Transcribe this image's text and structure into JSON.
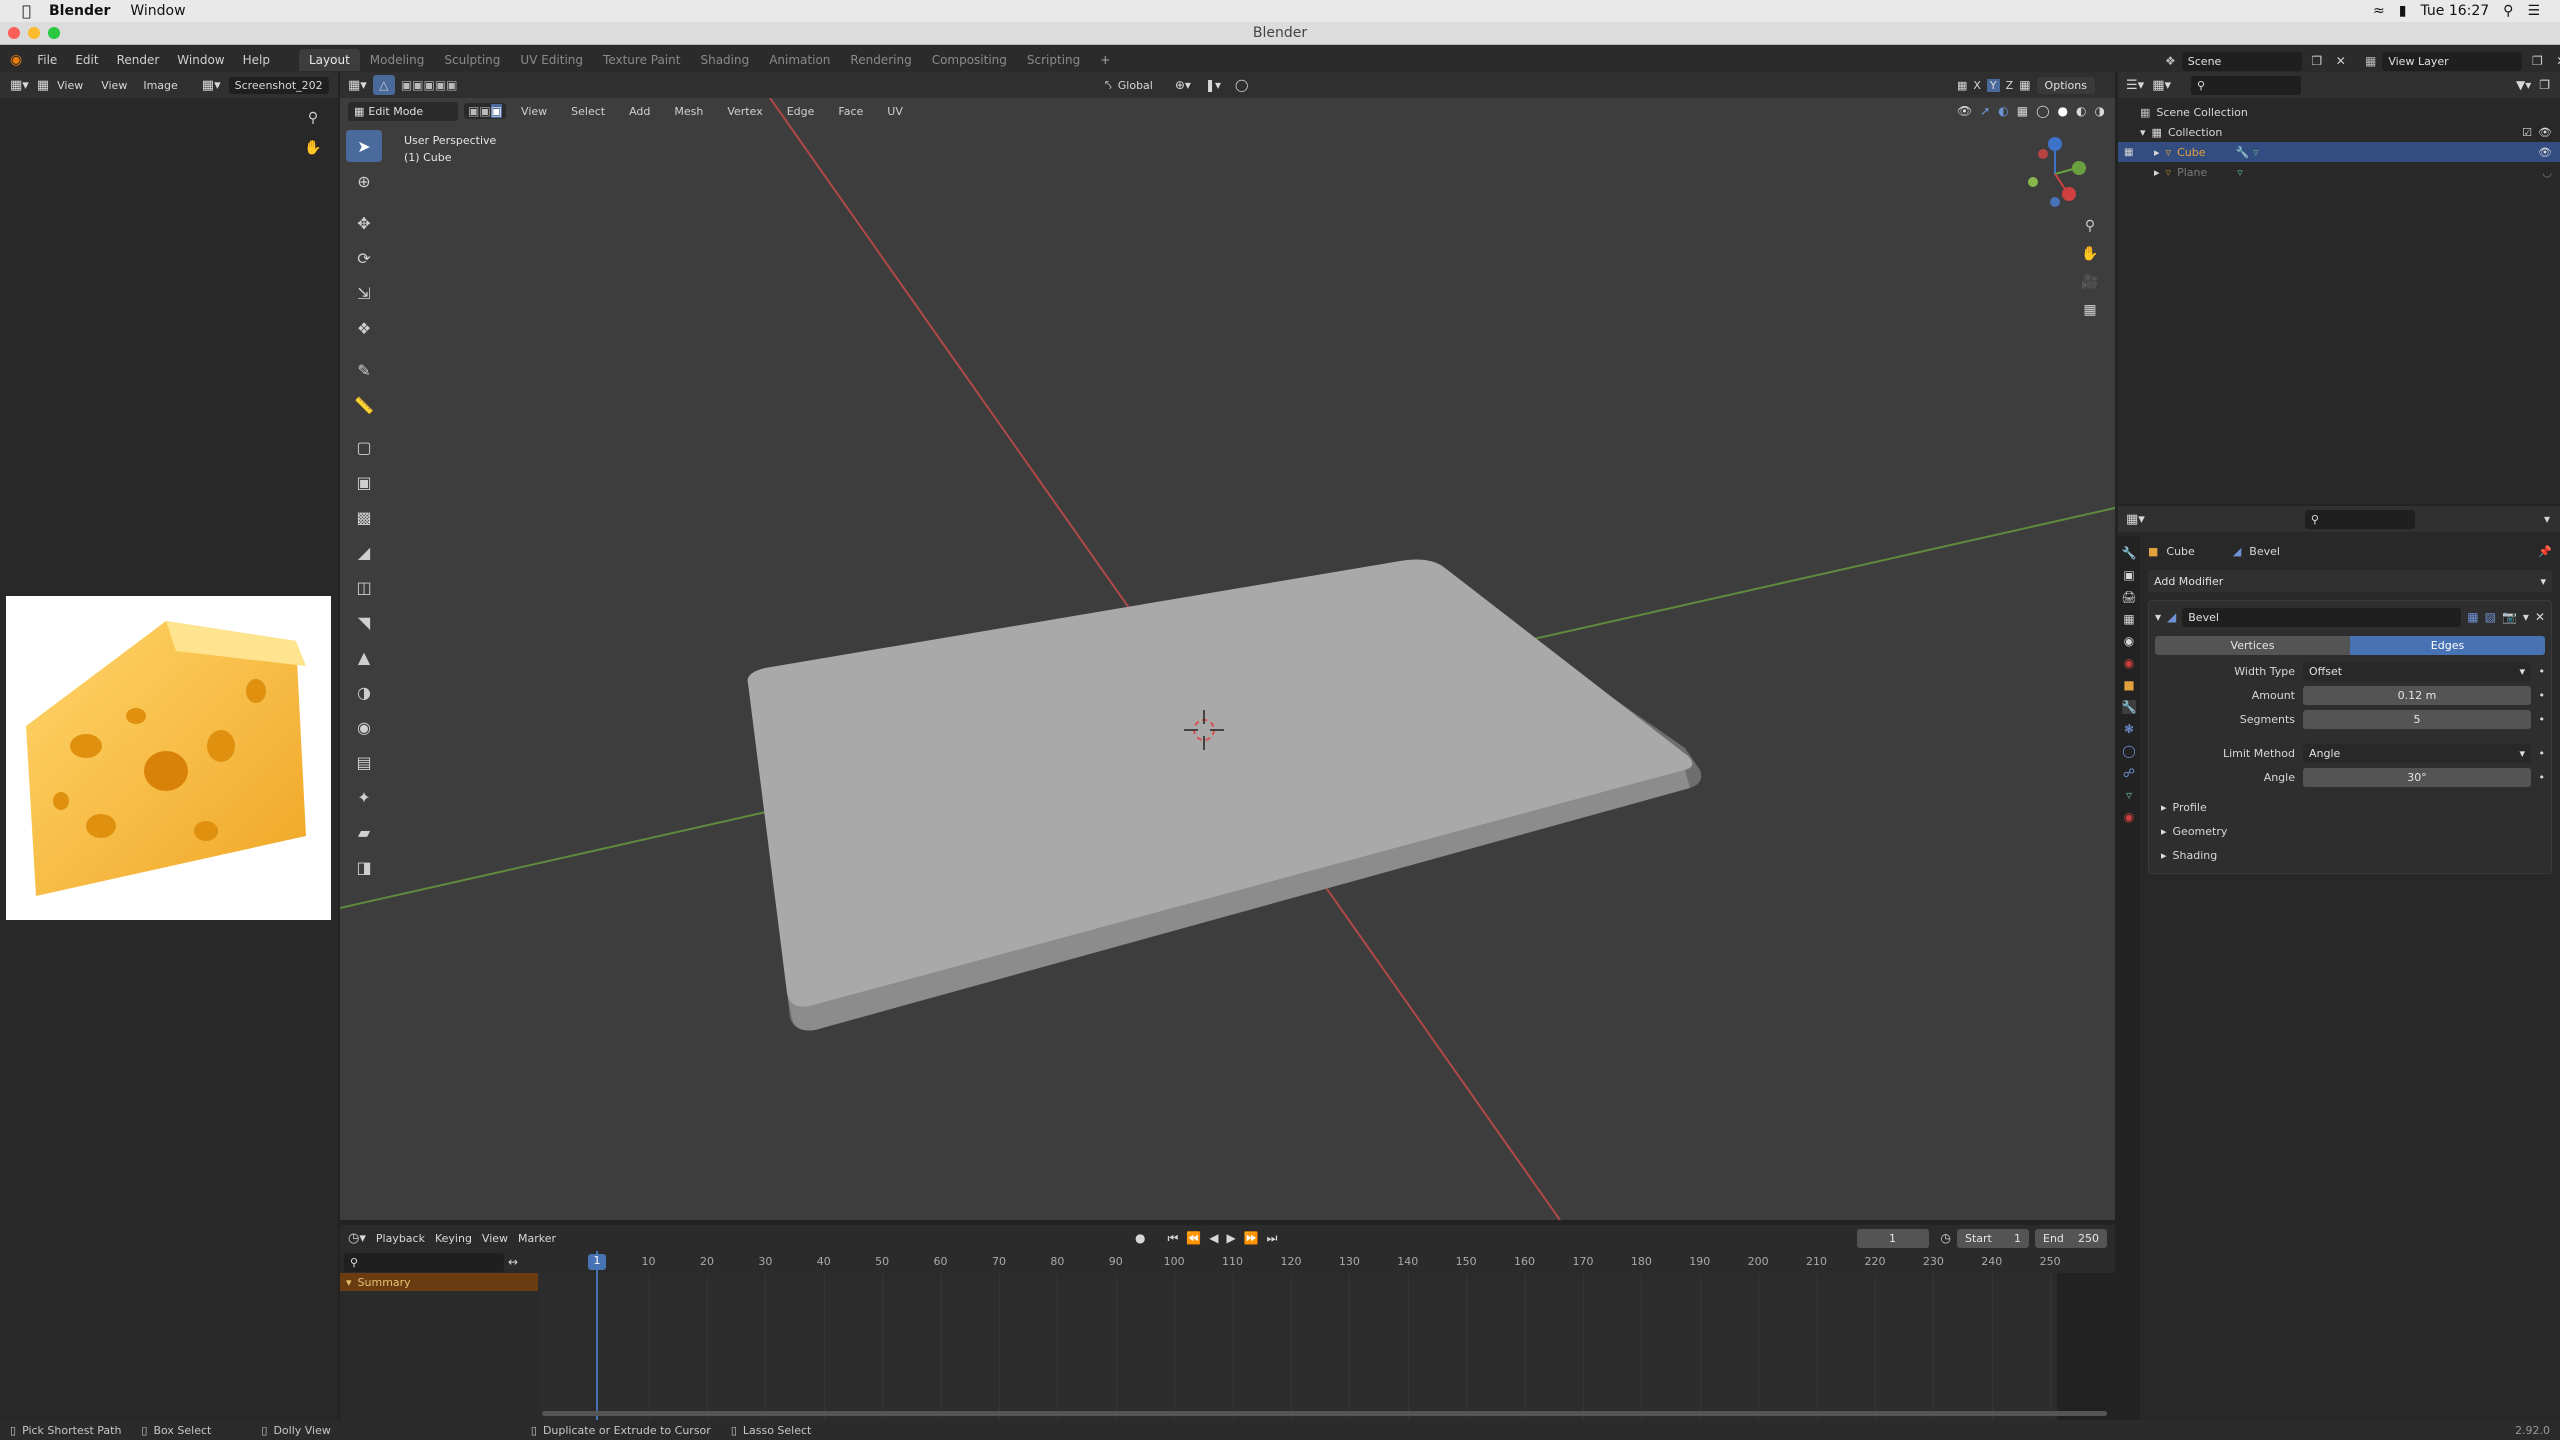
{
  "mac_menubar": {
    "app": "Blender",
    "menu": "Window",
    "clock": "Tue 16:27"
  },
  "window_title": "Blender",
  "topbar": {
    "menus": [
      "File",
      "Edit",
      "Render",
      "Window",
      "Help"
    ],
    "workspaces": [
      "Layout",
      "Modeling",
      "Sculpting",
      "UV Editing",
      "Texture Paint",
      "Shading",
      "Animation",
      "Rendering",
      "Compositing",
      "Scripting"
    ],
    "active_workspace": "Layout",
    "add_tab": "+",
    "scene_label": "Scene",
    "view_layer_label": "View Layer"
  },
  "image_editor": {
    "menus": [
      "View",
      "View",
      "Image"
    ],
    "image_name": "Screenshot_202"
  },
  "viewport": {
    "mode": "Edit Mode",
    "menus": [
      "View",
      "Select",
      "Add",
      "Mesh",
      "Vertex",
      "Edge",
      "Face",
      "UV"
    ],
    "transform_orientation": "Global",
    "options_label": "Options",
    "overlay_line1": "User Perspective",
    "overlay_line2": "(1) Cube",
    "axis_labels": [
      "X",
      "Y",
      "Z"
    ]
  },
  "outliner": {
    "rows": [
      {
        "label": "Scene Collection",
        "level": 0
      },
      {
        "label": "Collection",
        "level": 1
      },
      {
        "label": "Cube",
        "level": 2,
        "selected": true
      },
      {
        "label": "Plane",
        "level": 2,
        "selected": false
      }
    ]
  },
  "properties": {
    "object_name": "Cube",
    "modifier_name_header": "Bevel",
    "add_modifier": "Add Modifier",
    "modifier": {
      "name": "Bevel",
      "affect_options": [
        "Vertices",
        "Edges"
      ],
      "affect_selected": "Edges",
      "width_type_label": "Width Type",
      "width_type_value": "Offset",
      "amount_label": "Amount",
      "amount_value": "0.12 m",
      "segments_label": "Segments",
      "segments_value": "5",
      "limit_method_label": "Limit Method",
      "limit_method_value": "Angle",
      "angle_label": "Angle",
      "angle_value": "30°",
      "subpanels": [
        "Profile",
        "Geometry",
        "Shading"
      ]
    }
  },
  "timeline": {
    "menus": [
      "Playback",
      "Keying",
      "View",
      "Marker"
    ],
    "current_frame": "1",
    "start_label": "Start",
    "start_value": "1",
    "end_label": "End",
    "end_value": "250",
    "ticks": [
      "1",
      "10",
      "20",
      "30",
      "40",
      "50",
      "60",
      "70",
      "80",
      "90",
      "100",
      "110",
      "120",
      "130",
      "140",
      "150",
      "160",
      "170",
      "180",
      "190",
      "200",
      "210",
      "220",
      "230",
      "240",
      "250"
    ],
    "channel": "Summary"
  },
  "statusbar": {
    "hints": [
      "Pick Shortest Path",
      "Box Select",
      "Dolly View",
      "Duplicate or Extrude to Cursor",
      "Lasso Select"
    ],
    "version": "2.92.0"
  },
  "colors": {
    "accent_blue": "#4b6a9c",
    "selected_orange": "#e2a13c",
    "x_axis": "#d04040",
    "y_axis": "#6aa040"
  }
}
